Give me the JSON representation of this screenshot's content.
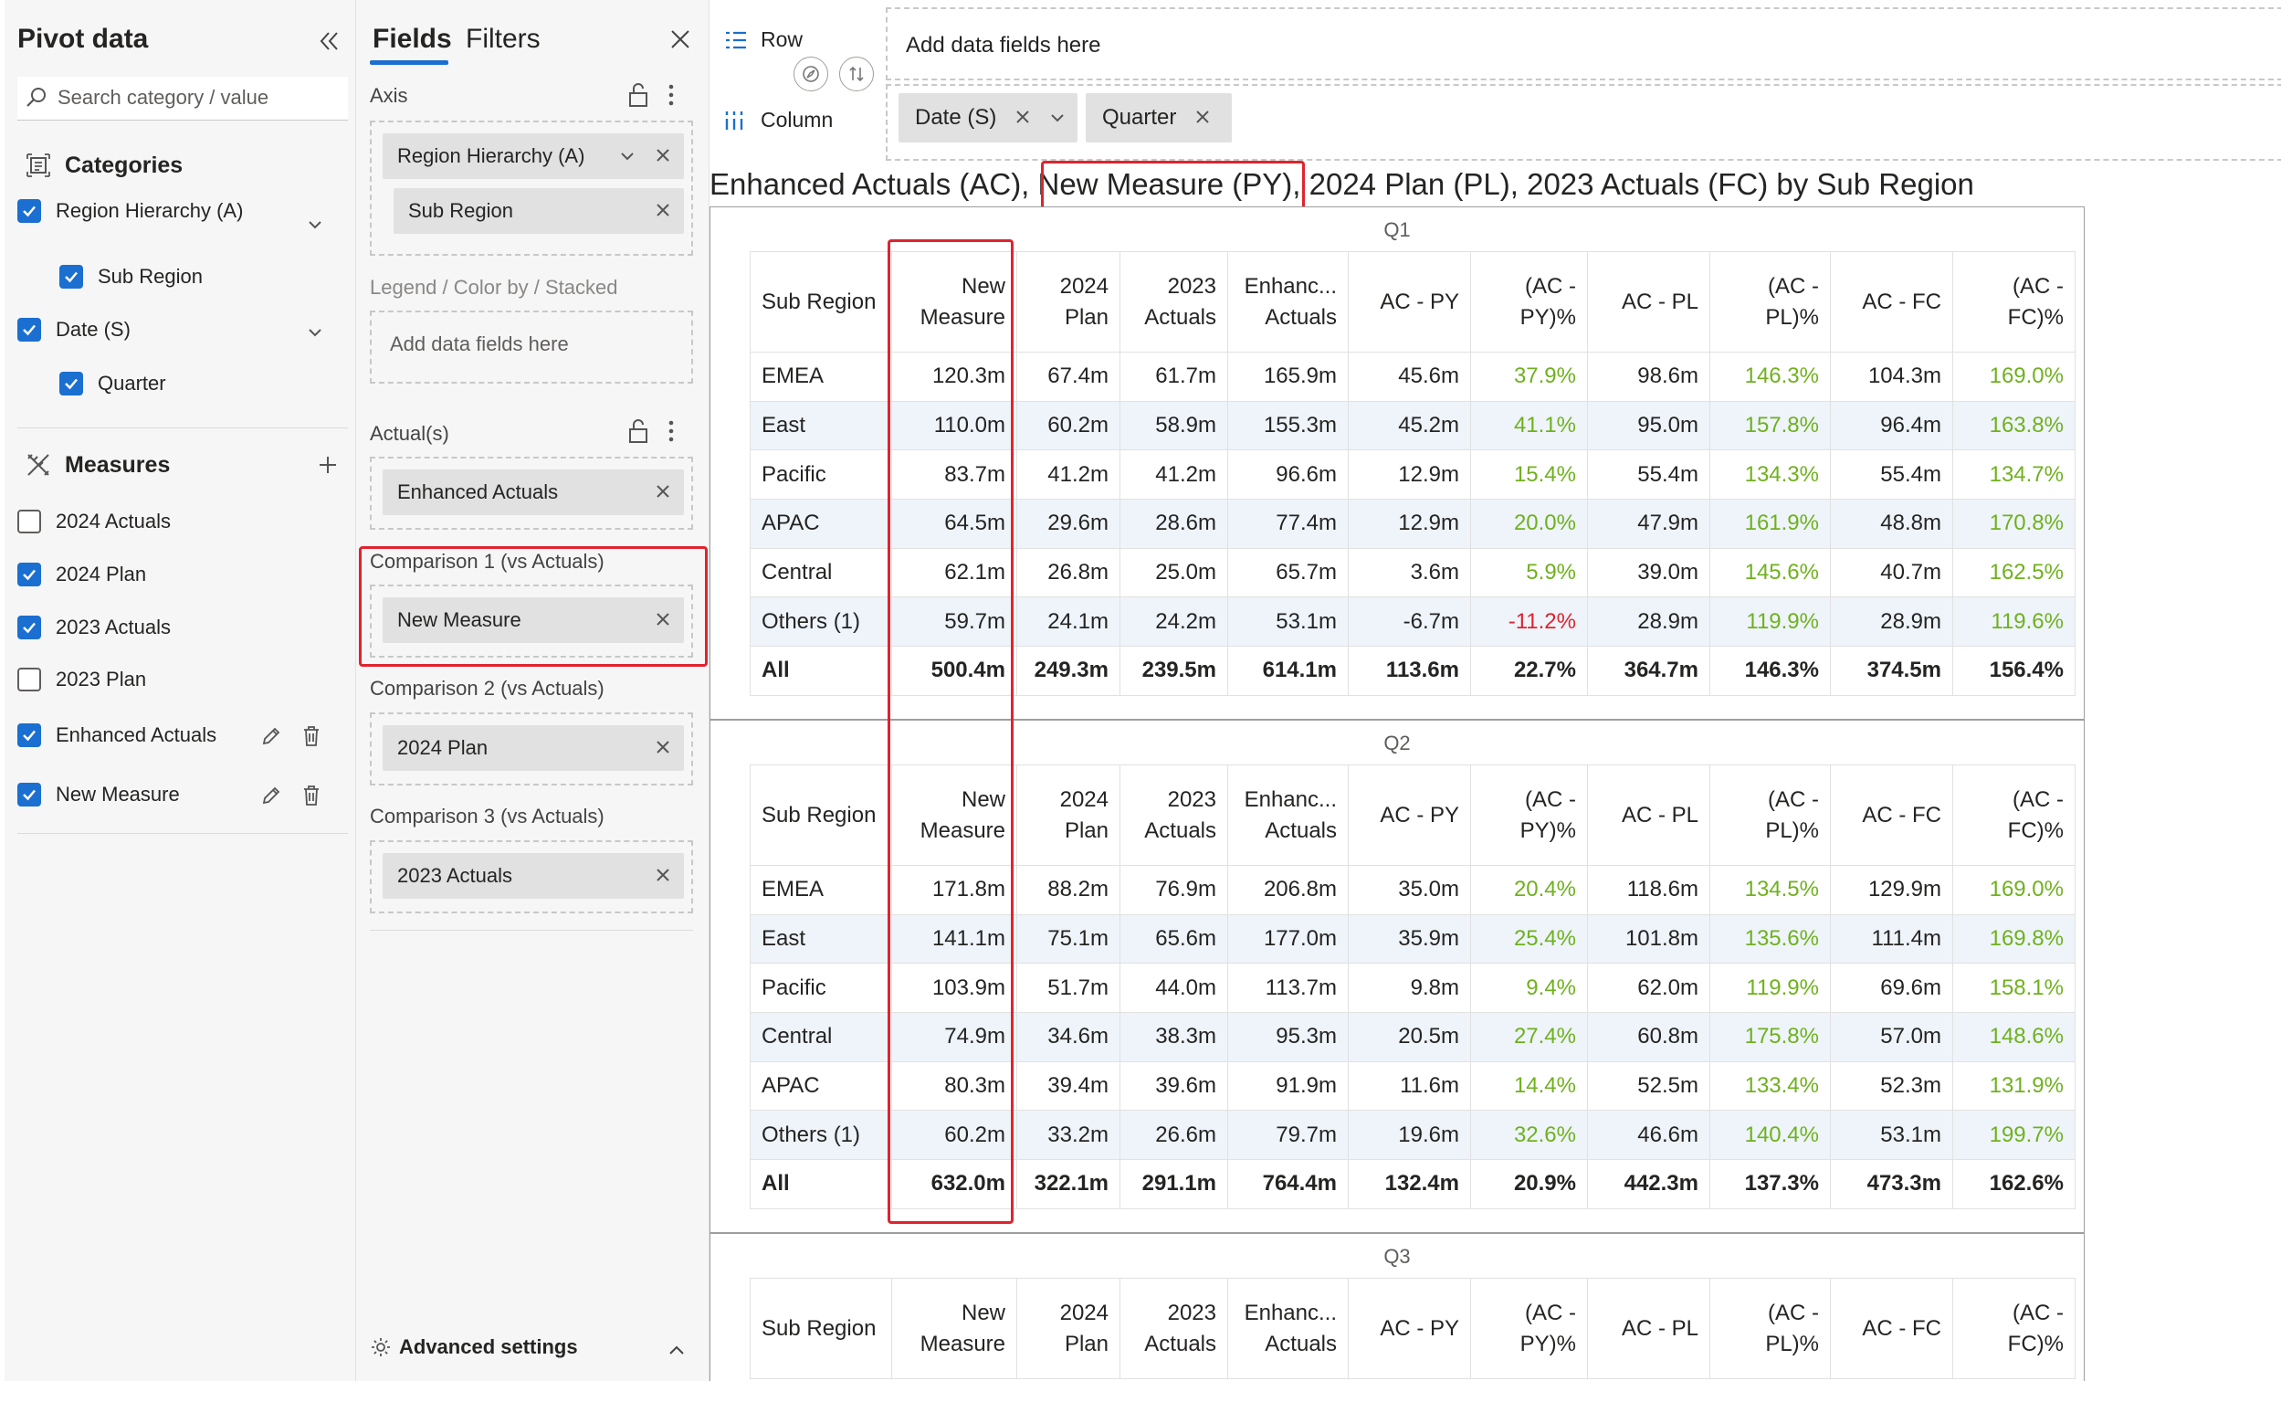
{
  "pivot_panel": {
    "title": "Pivot data",
    "search_placeholder": "Search category / value",
    "categories_heading": "Categories",
    "categories": [
      {
        "label": "Region Hierarchy (A)",
        "checked": true
      },
      {
        "label": "Sub Region",
        "checked": true
      },
      {
        "label": "Date (S)",
        "checked": true
      },
      {
        "label": "Quarter",
        "checked": true
      }
    ],
    "measures_heading": "Measures",
    "measures": [
      {
        "label": "2024 Actuals",
        "checked": false
      },
      {
        "label": "2024 Plan",
        "checked": true
      },
      {
        "label": "2023 Actuals",
        "checked": true
      },
      {
        "label": "2023 Plan",
        "checked": false
      },
      {
        "label": "Enhanced Actuals",
        "checked": true
      },
      {
        "label": "New Measure",
        "checked": true
      }
    ]
  },
  "fields_panel": {
    "tab_fields": "Fields",
    "tab_filters": "Filters",
    "axis_label": "Axis",
    "axis_chips": [
      "Region Hierarchy (A)",
      "Sub Region"
    ],
    "legend_label": "Legend / Color by / Stacked",
    "legend_placeholder": "Add data fields here",
    "actuals_label": "Actual(s)",
    "actuals_chip": "Enhanced Actuals",
    "comparison1_label": "Comparison 1 (vs Actuals)",
    "comparison1_chip": "New Measure",
    "comparison2_label": "Comparison 2 (vs Actuals)",
    "comparison2_chip": "2024 Plan",
    "comparison3_label": "Comparison 3 (vs Actuals)",
    "comparison3_chip": "2023 Actuals",
    "advanced_settings": "Advanced settings"
  },
  "main": {
    "row_label": "Row",
    "row_placeholder": "Add data fields here",
    "column_label": "Column",
    "column_chips": [
      "Date (S)",
      "Quarter"
    ],
    "title_prefix": "Enhanced Actuals (AC), ",
    "title_highlight": "New Measure (PY)",
    "title_suffix": ", 2024 Plan (PL), 2023 Actuals (FC) by Sub Region",
    "columns": [
      "Sub Region",
      "New Measure",
      "2024 Plan",
      "2023 Actuals",
      "Enhanc... Actuals",
      "AC - PY",
      "(AC - PY)%",
      "AC - PL",
      "(AC - PL)%",
      "AC - FC",
      "(AC - FC)%"
    ],
    "quarters": [
      {
        "label": "Q1",
        "rows": [
          [
            "EMEA",
            "120.3m",
            "67.4m",
            "61.7m",
            "165.9m",
            "45.6m",
            "37.9%",
            "98.6m",
            "146.3%",
            "104.3m",
            "169.0%"
          ],
          [
            "East",
            "110.0m",
            "60.2m",
            "58.9m",
            "155.3m",
            "45.2m",
            "41.1%",
            "95.0m",
            "157.8%",
            "96.4m",
            "163.8%"
          ],
          [
            "Pacific",
            "83.7m",
            "41.2m",
            "41.2m",
            "96.6m",
            "12.9m",
            "15.4%",
            "55.4m",
            "134.3%",
            "55.4m",
            "134.7%"
          ],
          [
            "APAC",
            "64.5m",
            "29.6m",
            "28.6m",
            "77.4m",
            "12.9m",
            "20.0%",
            "47.9m",
            "161.9%",
            "48.8m",
            "170.8%"
          ],
          [
            "Central",
            "62.1m",
            "26.8m",
            "25.0m",
            "65.7m",
            "3.6m",
            "5.9%",
            "39.0m",
            "145.6%",
            "40.7m",
            "162.5%"
          ],
          [
            "Others (1)",
            "59.7m",
            "24.1m",
            "24.2m",
            "53.1m",
            "-6.7m",
            "-11.2%",
            "28.9m",
            "119.9%",
            "28.9m",
            "119.6%"
          ]
        ],
        "total": [
          "All",
          "500.4m",
          "249.3m",
          "239.5m",
          "614.1m",
          "113.6m",
          "22.7%",
          "364.7m",
          "146.3%",
          "374.5m",
          "156.4%"
        ]
      },
      {
        "label": "Q2",
        "rows": [
          [
            "EMEA",
            "171.8m",
            "88.2m",
            "76.9m",
            "206.8m",
            "35.0m",
            "20.4%",
            "118.6m",
            "134.5%",
            "129.9m",
            "169.0%"
          ],
          [
            "East",
            "141.1m",
            "75.1m",
            "65.6m",
            "177.0m",
            "35.9m",
            "25.4%",
            "101.8m",
            "135.6%",
            "111.4m",
            "169.8%"
          ],
          [
            "Pacific",
            "103.9m",
            "51.7m",
            "44.0m",
            "113.7m",
            "9.8m",
            "9.4%",
            "62.0m",
            "119.9%",
            "69.6m",
            "158.1%"
          ],
          [
            "Central",
            "74.9m",
            "34.6m",
            "38.3m",
            "95.3m",
            "20.5m",
            "27.4%",
            "60.8m",
            "175.8%",
            "57.0m",
            "148.6%"
          ],
          [
            "APAC",
            "80.3m",
            "39.4m",
            "39.6m",
            "91.9m",
            "11.6m",
            "14.4%",
            "52.5m",
            "133.4%",
            "52.3m",
            "131.9%"
          ],
          [
            "Others (1)",
            "60.2m",
            "33.2m",
            "26.6m",
            "79.7m",
            "19.6m",
            "32.6%",
            "46.6m",
            "140.4%",
            "53.1m",
            "199.7%"
          ]
        ],
        "total": [
          "All",
          "632.0m",
          "322.1m",
          "291.1m",
          "764.4m",
          "132.4m",
          "20.9%",
          "442.3m",
          "137.3%",
          "473.3m",
          "162.6%"
        ]
      },
      {
        "label": "Q3",
        "rows": [],
        "total": null
      }
    ]
  },
  "colors": {
    "accent": "#1a6fd1",
    "positive": "#6fb11e",
    "negative": "#e0232e",
    "highlight_box": "#e0232e",
    "row_stripe": "#eef4fa"
  }
}
